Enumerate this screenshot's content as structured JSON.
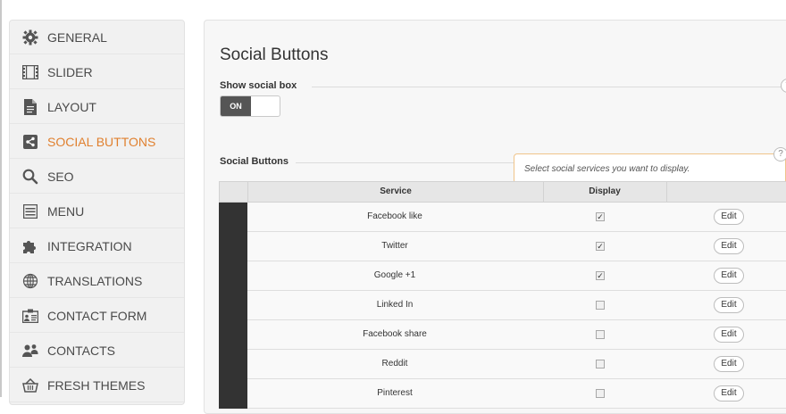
{
  "sidebar": {
    "items": [
      {
        "label": "GENERAL",
        "icon": "gear-icon"
      },
      {
        "label": "SLIDER",
        "icon": "film-icon"
      },
      {
        "label": "LAYOUT",
        "icon": "document-icon"
      },
      {
        "label": "SOCIAL BUTTONS",
        "icon": "share-icon",
        "active": true
      },
      {
        "label": "SEO",
        "icon": "search-icon"
      },
      {
        "label": "MENU",
        "icon": "menu-icon"
      },
      {
        "label": "INTEGRATION",
        "icon": "puzzle-icon"
      },
      {
        "label": "TRANSLATIONS",
        "icon": "globe-icon"
      },
      {
        "label": "CONTACT FORM",
        "icon": "contact-form-icon"
      },
      {
        "label": "CONTACTS",
        "icon": "users-icon"
      },
      {
        "label": "FRESH THEMES",
        "icon": "basket-icon"
      }
    ]
  },
  "main": {
    "title": "Social Buttons",
    "show_social_box": {
      "label": "Show social box",
      "toggle_on": "ON",
      "value": true
    },
    "social_buttons_section": "Social Buttons",
    "tooltip": "Select social services you want to display.",
    "help_icon": "?",
    "table": {
      "headers": {
        "service": "Service",
        "display": "Display"
      },
      "edit_label": "Edit",
      "rows": [
        {
          "service": "Facebook like",
          "display": true
        },
        {
          "service": "Twitter",
          "display": true
        },
        {
          "service": "Google +1",
          "display": true
        },
        {
          "service": "Linked In",
          "display": false
        },
        {
          "service": "Facebook share",
          "display": false
        },
        {
          "service": "Reddit",
          "display": false
        },
        {
          "service": "Pinterest",
          "display": false
        }
      ]
    }
  },
  "colors": {
    "active": "#e0802f",
    "handle": "#333333",
    "toggle_on": "#555555"
  }
}
